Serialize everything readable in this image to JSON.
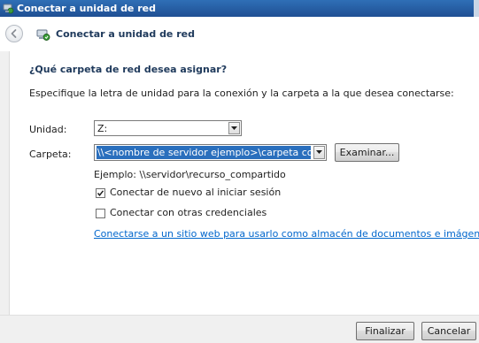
{
  "window": {
    "title": "Conectar a unidad de red"
  },
  "header": {
    "title": "Conectar a unidad de red"
  },
  "main": {
    "question": "¿Qué carpeta de red desea asignar?",
    "description": "Especifique la letra de unidad para la conexión y la carpeta a la que desea conectarse:",
    "drive": {
      "label": "Unidad:",
      "value": "Z:"
    },
    "folder": {
      "label": "Carpeta:",
      "value": "\\\\<nombre de servidor ejemplo>\\carpeta compartida",
      "browse_label": "Examinar..."
    },
    "example": "Ejemplo: \\\\servidor\\recurso_compartido",
    "reconnect": {
      "label": "Conectar de nuevo al iniciar sesión",
      "checked": true
    },
    "other_credentials": {
      "label": "Conectar con otras credenciales",
      "checked": false
    },
    "website_link": "Conectarse a un sitio web para usarlo como almacén de documentos e imágenes",
    "website_link_suffix": "."
  },
  "footer": {
    "finish_label": "Finalizar",
    "cancel_label": "Cancelar"
  },
  "colors": {
    "titlebar": "#1f4f93",
    "header_text": "#1e395b",
    "link": "#0066cc",
    "selection": "#2a6fbd"
  },
  "icons": {
    "window": "network-drive-icon",
    "back": "back-arrow-icon",
    "dropdown": "chevron-down-icon",
    "check": "checkmark-icon"
  }
}
